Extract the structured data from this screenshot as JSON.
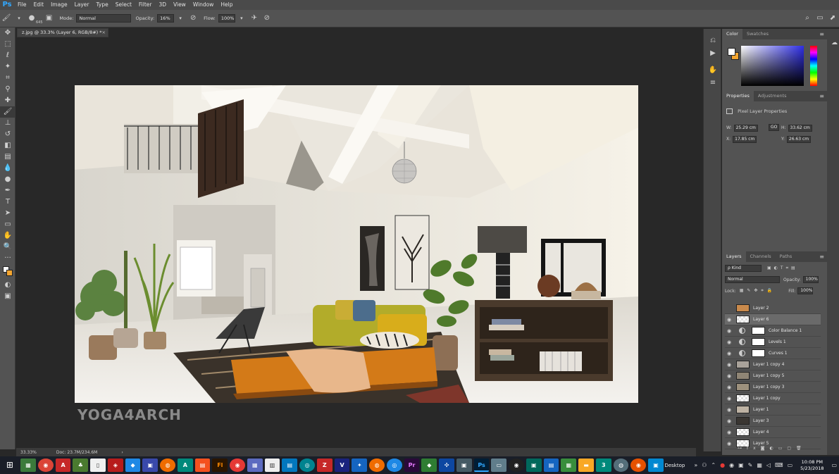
{
  "app": {
    "logo": "Ps"
  },
  "menu": [
    "File",
    "Edit",
    "Image",
    "Layer",
    "Type",
    "Select",
    "Filter",
    "3D",
    "View",
    "Window",
    "Help"
  ],
  "options": {
    "brush_size": "645",
    "mode_label": "Mode:",
    "mode_value": "Normal",
    "opacity_label": "Opacity:",
    "opacity_value": "16%",
    "flow_label": "Flow:",
    "flow_value": "100%"
  },
  "document": {
    "tab_title": "z.jpg @ 33.3% (Layer 6, RGB/8#) *",
    "close": "×",
    "watermark": "YOGA4ARCH"
  },
  "status": {
    "zoom": "33.33%",
    "doc": "Doc: 23.7M/234.6M",
    "arrow": "›"
  },
  "color_panel": {
    "tabs": [
      "Color",
      "Swatches"
    ],
    "fg": "#ffffff",
    "bg": "#f3a530"
  },
  "properties": {
    "tabs": [
      "Properties",
      "Adjustments"
    ],
    "title": "Pixel Layer Properties",
    "w_label": "W:",
    "w": "25.29 cm",
    "h_label": "H:",
    "h": "33.62 cm",
    "x_label": "X:",
    "x": "17.85 cm",
    "y_label": "Y:",
    "y": "26.63 cm",
    "link": "GO"
  },
  "layers": {
    "tabs": [
      "Layers",
      "Channels",
      "Paths"
    ],
    "kind": "ρ Kind",
    "blend": "Normal",
    "opacity_label": "Opacity:",
    "opacity": "100%",
    "lock_label": "Lock:",
    "fill_label": "Fill:",
    "fill": "100%",
    "items": [
      {
        "name": "Layer 2",
        "visible": false,
        "type": "pixel"
      },
      {
        "name": "Layer 6",
        "visible": true,
        "type": "pixel",
        "selected": true
      },
      {
        "name": "Color Balance 1",
        "visible": true,
        "type": "adjustment"
      },
      {
        "name": "Levels 1",
        "visible": true,
        "type": "adjustment"
      },
      {
        "name": "Curves 1",
        "visible": true,
        "type": "adjustment"
      },
      {
        "name": "Layer 1 copy 4",
        "visible": true,
        "type": "pixel"
      },
      {
        "name": "Layer 1 copy 5",
        "visible": true,
        "type": "pixel"
      },
      {
        "name": "Layer 1 copy 3",
        "visible": true,
        "type": "pixel"
      },
      {
        "name": "Layer 1 copy",
        "visible": true,
        "type": "pixel"
      },
      {
        "name": "Layer 1",
        "visible": true,
        "type": "pixel"
      },
      {
        "name": "Layer 3",
        "visible": true,
        "type": "pixel"
      },
      {
        "name": "Layer 4",
        "visible": true,
        "type": "pixel"
      },
      {
        "name": "Layer 5",
        "visible": true,
        "type": "pixel"
      }
    ]
  },
  "taskbar": {
    "desktop_label": "Desktop",
    "time": "10:08 PM",
    "date": "5/23/2018"
  }
}
